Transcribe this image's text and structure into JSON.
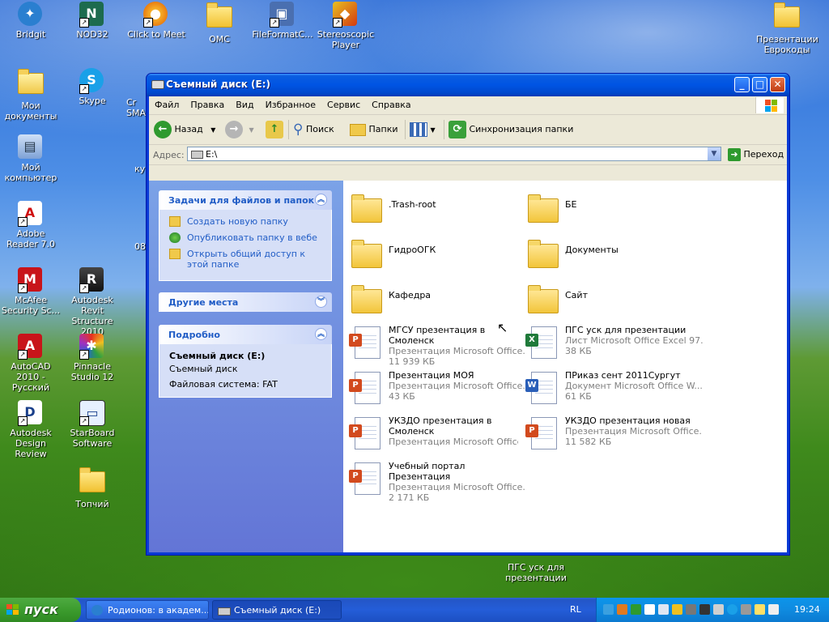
{
  "desktop": {
    "icons": [
      {
        "label": "Bridgit"
      },
      {
        "label": "NOD32"
      },
      {
        "label": "Click to Meet"
      },
      {
        "label": "OMC"
      },
      {
        "label": "FileFormatC..."
      },
      {
        "label": "Stereoscopic Player"
      },
      {
        "label": "Презентации Еврокоды"
      },
      {
        "label": "Мои документы"
      },
      {
        "label": "Skype"
      },
      {
        "label": "Мой компьютер"
      },
      {
        "label": "Adobe Reader 7.0"
      },
      {
        "label": "McAfee Security Sc..."
      },
      {
        "label": "Autodesk Revit Structure 2010"
      },
      {
        "label": "AutoCAD 2010 - Русский"
      },
      {
        "label": "Pinnacle Studio 12"
      },
      {
        "label": "Autodesk Design Review"
      },
      {
        "label": "StarBoard Software"
      },
      {
        "label": "Топчий"
      },
      {
        "label": "ПГС уск для презентации"
      }
    ],
    "partial_labels": {
      "p1": "Cr",
      "p2": "SMA",
      "p3": "ку",
      "p4": "08"
    }
  },
  "window": {
    "title": "Съемный диск (E:)",
    "menu": [
      "Файл",
      "Правка",
      "Вид",
      "Избранное",
      "Сервис",
      "Справка"
    ],
    "toolbar": {
      "back": "Назад",
      "search": "Поиск",
      "folders": "Папки",
      "sync": "Синхронизация папки"
    },
    "address": {
      "label": "Адрес:",
      "value": "E:\\",
      "go": "Переход"
    },
    "taskpane": {
      "file_tasks": {
        "title": "Задачи для файлов и папок",
        "links": [
          "Создать новую папку",
          "Опубликовать папку в вебе",
          "Открыть общий доступ к этой папке"
        ]
      },
      "other_places": {
        "title": "Другие места"
      },
      "details": {
        "title": "Подробно",
        "name": "Съемный диск (E:)",
        "type": "Съемный диск",
        "fs": "Файловая система: FAT"
      }
    },
    "items": [
      {
        "name": ".Trash-root",
        "kind": "folder"
      },
      {
        "name": "БЕ",
        "kind": "folder"
      },
      {
        "name": "ГидроОГК",
        "kind": "folder"
      },
      {
        "name": "Документы",
        "kind": "folder"
      },
      {
        "name": "Кафедра",
        "kind": "folder"
      },
      {
        "name": "Сайт",
        "kind": "folder"
      },
      {
        "name": "МГСУ презентация в Смоленск",
        "type": "Презентация Microsoft Office...",
        "size": "11 939 КБ",
        "kind": "ppt"
      },
      {
        "name": "ПГС уск для презентации",
        "type": "Лист Microsoft Office Excel 97...",
        "size": "38 КБ",
        "kind": "xls"
      },
      {
        "name": "Презентация МОЯ",
        "type": "Презентация Microsoft Office...",
        "size": "43 КБ",
        "kind": "ppt"
      },
      {
        "name": "ПРиказ сент 2011Сургут",
        "type": "Документ Microsoft Office W...",
        "size": "61 КБ",
        "kind": "doc"
      },
      {
        "name": "УКЗДО презентация в Смоленск",
        "type": "Презентация Microsoft Office...",
        "size": "",
        "kind": "ppt"
      },
      {
        "name": "УКЗДО презентация новая",
        "type": "Презентация Microsoft Office...",
        "size": "11 582 КБ",
        "kind": "ppt"
      },
      {
        "name": "Учебный портал Презентация",
        "type": "Презентация Microsoft Office...",
        "size": "2 171 КБ",
        "kind": "ppt"
      }
    ]
  },
  "taskbar": {
    "start": "пуск",
    "tasks": [
      {
        "label": "Родионов: в академ..."
      },
      {
        "label": "Съемный диск (E:)"
      }
    ],
    "lang": "RL",
    "clock": "19:24"
  },
  "colors": {
    "xp_blue": "#0054e3",
    "start_green": "#3c9c2e",
    "tray_blue": "#0f8be0",
    "link_blue": "#215dc6"
  }
}
